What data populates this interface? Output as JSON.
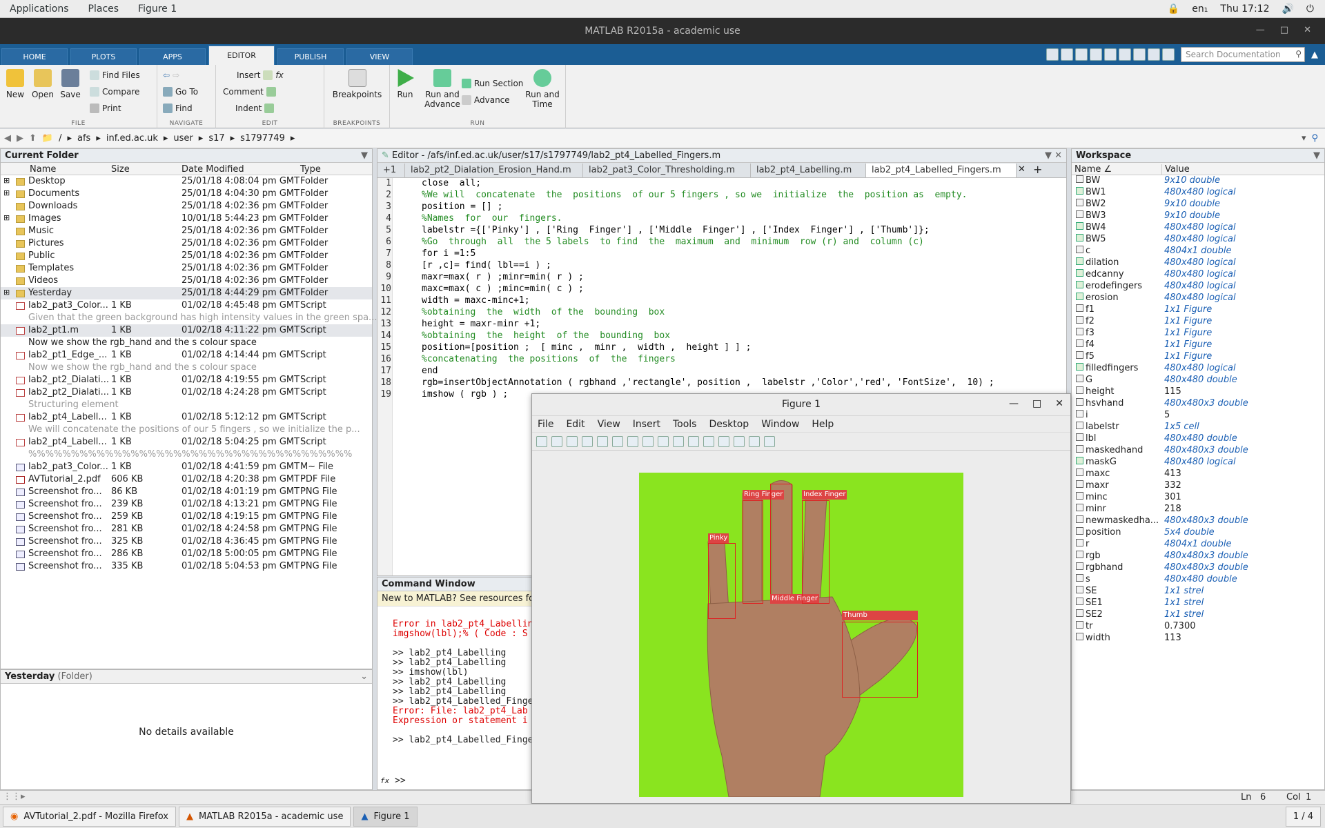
{
  "topbar": {
    "applications": "Applications",
    "places": "Places",
    "figure": "Figure 1",
    "lang": "en₁",
    "clock": "Thu 17:12"
  },
  "window": {
    "title": "MATLAB R2015a - academic use"
  },
  "ribbon_tabs": [
    "HOME",
    "PLOTS",
    "APPS",
    "EDITOR",
    "PUBLISH",
    "VIEW"
  ],
  "doc_search_placeholder": "Search Documentation",
  "ribbon": {
    "file": {
      "new": "New",
      "open": "Open",
      "save": "Save",
      "find_files": "Find Files",
      "compare": "Compare",
      "print": "Print",
      "label": "FILE"
    },
    "navigate": {
      "goto": "Go To",
      "find": "Find",
      "label": "NAVIGATE"
    },
    "edit": {
      "insert": "Insert",
      "comment": "Comment",
      "indent": "Indent",
      "label": "EDIT"
    },
    "breakpoints": {
      "btn": "Breakpoints",
      "label": "BREAKPOINTS"
    },
    "run": {
      "run": "Run",
      "run_advance": "Run and\nAdvance",
      "run_section": "Run Section",
      "advance": "Advance",
      "run_time": "Run and\nTime",
      "label": "RUN"
    }
  },
  "address": [
    "/",
    "afs",
    "inf.ed.ac.uk",
    "user",
    "s17",
    "s1797749"
  ],
  "current_folder": {
    "title": "Current Folder",
    "columns": [
      "Name",
      "Size",
      "Date Modified",
      "Type"
    ],
    "rows": [
      {
        "name": "Desktop",
        "size": "",
        "date": "25/01/18  4:08:04 pm GMT",
        "type": "Folder",
        "kind": "folder",
        "expand": true
      },
      {
        "name": "Documents",
        "size": "",
        "date": "25/01/18  4:04:30 pm GMT",
        "type": "Folder",
        "kind": "folder",
        "expand": true
      },
      {
        "name": "Downloads",
        "size": "",
        "date": "25/01/18  4:02:36 pm GMT",
        "type": "Folder",
        "kind": "folder"
      },
      {
        "name": "Images",
        "size": "",
        "date": "10/01/18  5:44:23 pm GMT",
        "type": "Folder",
        "kind": "folder",
        "expand": true
      },
      {
        "name": "Music",
        "size": "",
        "date": "25/01/18  4:02:36 pm GMT",
        "type": "Folder",
        "kind": "folder"
      },
      {
        "name": "Pictures",
        "size": "",
        "date": "25/01/18  4:02:36 pm GMT",
        "type": "Folder",
        "kind": "folder"
      },
      {
        "name": "Public",
        "size": "",
        "date": "25/01/18  4:02:36 pm GMT",
        "type": "Folder",
        "kind": "folder"
      },
      {
        "name": "Templates",
        "size": "",
        "date": "25/01/18  4:02:36 pm GMT",
        "type": "Folder",
        "kind": "folder"
      },
      {
        "name": "Videos",
        "size": "",
        "date": "25/01/18  4:02:36 pm GMT",
        "type": "Folder",
        "kind": "folder"
      },
      {
        "name": "Yesterday",
        "size": "",
        "date": "25/01/18  4:44:29 pm GMT",
        "type": "Folder",
        "kind": "folder",
        "expand": true,
        "sel": true
      },
      {
        "name": "lab2_pat3_Color...",
        "size": "1 KB",
        "date": "01/02/18  4:45:48 pm GMT",
        "type": "Script",
        "kind": "mfile"
      },
      {
        "desc": "Given that the green background has high intensity values in the green spa..."
      },
      {
        "name": "lab2_pt1.m",
        "size": "1 KB",
        "date": "01/02/18  4:11:22 pm GMT",
        "type": "Script",
        "kind": "mfile",
        "sel": true
      },
      {
        "desc": "Now we show  the  rgb_hand  and  the s colour  space",
        "dark": true
      },
      {
        "name": "lab2_pt1_Edge_...",
        "size": "1 KB",
        "date": "01/02/18  4:14:44 pm GMT",
        "type": "Script",
        "kind": "mfile"
      },
      {
        "desc": "Now we show  the  rgb_hand  and  the s colour  space"
      },
      {
        "name": "lab2_pt2_Dialati...",
        "size": "1 KB",
        "date": "01/02/18  4:19:55 pm GMT",
        "type": "Script",
        "kind": "mfile"
      },
      {
        "name": "lab2_pt2_Dialati...",
        "size": "1 KB",
        "date": "01/02/18  4:24:28 pm GMT",
        "type": "Script",
        "kind": "mfile"
      },
      {
        "desc": "Structuring element"
      },
      {
        "name": "lab2_pt4_Labell...",
        "size": "1 KB",
        "date": "01/02/18  5:12:12 pm GMT",
        "type": "Script",
        "kind": "mfile"
      },
      {
        "desc": "We will  concatenate  the  positions  of our 5 fingers , so we  initialize  the  p..."
      },
      {
        "name": "lab2_pt4_Labell...",
        "size": "1 KB",
        "date": "01/02/18  5:04:25 pm GMT",
        "type": "Script",
        "kind": "mfile"
      },
      {
        "desc": "%%%%%%%%%%%%%%%%%%%%%%%%%%%%%%%%%%%%%%"
      },
      {
        "name": "lab2_pat3_Color...",
        "size": "1 KB",
        "date": "01/02/18  4:41:59 pm GMT",
        "type": "M~ File",
        "kind": "png"
      },
      {
        "name": "AVTutorial_2.pdf",
        "size": "606 KB",
        "date": "01/02/18  4:20:38 pm GMT",
        "type": "PDF File",
        "kind": "pdf"
      },
      {
        "name": "Screenshot fro...",
        "size": "86 KB",
        "date": "01/02/18  4:01:19 pm GMT",
        "type": "PNG File",
        "kind": "png"
      },
      {
        "name": "Screenshot fro...",
        "size": "239 KB",
        "date": "01/02/18  4:13:21 pm GMT",
        "type": "PNG File",
        "kind": "png"
      },
      {
        "name": "Screenshot fro...",
        "size": "259 KB",
        "date": "01/02/18  4:19:15 pm GMT",
        "type": "PNG File",
        "kind": "png"
      },
      {
        "name": "Screenshot fro...",
        "size": "281 KB",
        "date": "01/02/18  4:24:58 pm GMT",
        "type": "PNG File",
        "kind": "png"
      },
      {
        "name": "Screenshot fro...",
        "size": "325 KB",
        "date": "01/02/18  4:36:45 pm GMT",
        "type": "PNG File",
        "kind": "png"
      },
      {
        "name": "Screenshot fro...",
        "size": "286 KB",
        "date": "01/02/18  5:00:05 pm GMT",
        "type": "PNG File",
        "kind": "png"
      },
      {
        "name": "Screenshot fro...",
        "size": "335 KB",
        "date": "01/02/18  5:04:53 pm GMT",
        "type": "PNG File",
        "kind": "png"
      }
    ]
  },
  "details": {
    "title": "Yesterday",
    "subtitle": "(Folder)",
    "empty": "No details available"
  },
  "editor": {
    "title": "Editor - /afs/inf.ed.ac.uk/user/s17/s1797749/lab2_pt4_Labelled_Fingers.m",
    "tabs": [
      "lab2_pt2_Dialation_Erosion_Hand.m",
      "lab2_pat3_Color_Thresholding.m",
      "lab2_pt4_Labelling.m",
      "lab2_pt4_Labelled_Fingers.m"
    ],
    "lines": [
      {
        "n": "1",
        "t": "close  all;"
      },
      {
        "n": "2",
        "t": "%We will  concatenate  the  positions  of our 5 fingers , so we  initialize  the  position as  empty.",
        "c": true
      },
      {
        "n": "3",
        "t": "position = [] ;"
      },
      {
        "n": "4",
        "t": "%Names  for  our  fingers.",
        "c": true
      },
      {
        "n": "5",
        "t": "labelstr ={['Pinky'] , ['Ring  Finger'] , ['Middle  Finger'] , ['Index  Finger'] , ['Thumb']};"
      },
      {
        "n": "6",
        "t": "%Go  through  all  the 5 labels  to find  the  maximum  and  minimum  row (r) and  column (c)",
        "c": true
      },
      {
        "n": "7",
        "t": "for i =1:5"
      },
      {
        "n": "8",
        "t": "[r ,c]= find( lbl==i ) ;"
      },
      {
        "n": "9",
        "t": "maxr=max( r ) ;minr=min( r ) ;"
      },
      {
        "n": "10",
        "t": "maxc=max( c ) ;minc=min( c ) ;"
      },
      {
        "n": "11",
        "t": "width = maxc-minc+1;"
      },
      {
        "n": "12",
        "t": "%obtaining  the  width  of the  bounding  box",
        "c": true
      },
      {
        "n": "13",
        "t": "height = maxr-minr +1;"
      },
      {
        "n": "14",
        "t": "%obtaining  the  height  of the  bounding  box",
        "c": true
      },
      {
        "n": "15",
        "t": "position=[position ;  [ minc ,  minr ,  width ,  height ] ] ;"
      },
      {
        "n": "16",
        "t": "%concatenating  the positions  of  the  fingers",
        "c": true
      },
      {
        "n": "17",
        "t": "end"
      },
      {
        "n": "18",
        "t": "rgb=insertObjectAnnotation ( rgbhand ,'rectangle', position ,  labelstr ,'Color','red', 'FontSize',  10) ;"
      },
      {
        "n": "19",
        "t": "imshow ( rgb ) ;"
      }
    ]
  },
  "command": {
    "title": "Command Window",
    "banner": "New to MATLAB? See resources for",
    "lines": [
      {
        "t": "Error in lab2_pt4_Labellin",
        "e": true
      },
      {
        "t": "imgshow(lbl);% ( Code : S",
        "e": true
      },
      {
        "t": ""
      },
      {
        "t": ">> lab2_pt4_Labelling"
      },
      {
        "t": ">> lab2_pt4_Labelling"
      },
      {
        "t": ">> imshow(lbl)"
      },
      {
        "t": ">> lab2_pt4_Labelling"
      },
      {
        "t": ">> lab2_pt4_Labelling"
      },
      {
        "t": ">> lab2_pt4_Labelled_Finge"
      },
      {
        "t": "Error: File: lab2_pt4_Lab",
        "e": true
      },
      {
        "t": "Expression or statement i",
        "e": true
      },
      {
        "t": ""
      },
      {
        "t": ">> lab2_pt4_Labelled_Finge"
      }
    ],
    "prompt": ">>"
  },
  "workspace": {
    "title": "Workspace",
    "columns": [
      "Name ∠",
      "Value"
    ],
    "rows": [
      {
        "n": "BW",
        "v": "9x10 double",
        "i": "grid"
      },
      {
        "n": "BW1",
        "v": "480x480 logical",
        "i": "chk"
      },
      {
        "n": "BW2",
        "v": "9x10 double",
        "i": "grid"
      },
      {
        "n": "BW3",
        "v": "9x10 double",
        "i": "grid"
      },
      {
        "n": "BW4",
        "v": "480x480 logical",
        "i": "chk"
      },
      {
        "n": "BW5",
        "v": "480x480 logical",
        "i": "chk"
      },
      {
        "n": "c",
        "v": "4804x1 double",
        "i": "grid"
      },
      {
        "n": "dilation",
        "v": "480x480 logical",
        "i": "chk"
      },
      {
        "n": "edcanny",
        "v": "480x480 logical",
        "i": "chk"
      },
      {
        "n": "erodefingers",
        "v": "480x480 logical",
        "i": "chk"
      },
      {
        "n": "erosion",
        "v": "480x480 logical",
        "i": "chk"
      },
      {
        "n": "f1",
        "v": "1x1 Figure",
        "i": "obj"
      },
      {
        "n": "f2",
        "v": "1x1 Figure",
        "i": "obj"
      },
      {
        "n": "f3",
        "v": "1x1 Figure",
        "i": "obj"
      },
      {
        "n": "f4",
        "v": "1x1 Figure",
        "i": "obj"
      },
      {
        "n": "f5",
        "v": "1x1 Figure",
        "i": "obj"
      },
      {
        "n": "filledfingers",
        "v": "480x480 logical",
        "i": "chk"
      },
      {
        "n": "G",
        "v": "480x480 double",
        "i": "grid"
      },
      {
        "n": "height",
        "v": "115",
        "i": "grid",
        "p": true
      },
      {
        "n": "hsvhand",
        "v": "480x480x3 double",
        "i": "grid"
      },
      {
        "n": "i",
        "v": "5",
        "i": "grid",
        "p": true
      },
      {
        "n": "labelstr",
        "v": "1x5 cell",
        "i": "cell"
      },
      {
        "n": "lbl",
        "v": "480x480 double",
        "i": "grid"
      },
      {
        "n": "maskedhand",
        "v": "480x480x3 double",
        "i": "grid"
      },
      {
        "n": "maskG",
        "v": "480x480 logical",
        "i": "chk"
      },
      {
        "n": "maxc",
        "v": "413",
        "i": "grid",
        "p": true
      },
      {
        "n": "maxr",
        "v": "332",
        "i": "grid",
        "p": true
      },
      {
        "n": "minc",
        "v": "301",
        "i": "grid",
        "p": true
      },
      {
        "n": "minr",
        "v": "218",
        "i": "grid",
        "p": true
      },
      {
        "n": "newmaskedha...",
        "v": "480x480x3 double",
        "i": "grid"
      },
      {
        "n": "position",
        "v": "5x4 double",
        "i": "grid"
      },
      {
        "n": "r",
        "v": "4804x1 double",
        "i": "grid"
      },
      {
        "n": "rgb",
        "v": "480x480x3 double",
        "i": "grid"
      },
      {
        "n": "rgbhand",
        "v": "480x480x3 double",
        "i": "grid"
      },
      {
        "n": "s",
        "v": "480x480 double",
        "i": "grid"
      },
      {
        "n": "SE",
        "v": "1x1 strel",
        "i": "obj"
      },
      {
        "n": "SE1",
        "v": "1x1 strel",
        "i": "obj"
      },
      {
        "n": "SE2",
        "v": "1x1 strel",
        "i": "obj"
      },
      {
        "n": "tr",
        "v": "0.7300",
        "i": "grid",
        "p": true
      },
      {
        "n": "width",
        "v": "113",
        "i": "grid",
        "p": true
      }
    ]
  },
  "status": {
    "ln_label": "Ln",
    "ln": "6",
    "col_label": "Col",
    "col": "1"
  },
  "figure": {
    "title": "Figure 1",
    "menu": [
      "File",
      "Edit",
      "View",
      "Insert",
      "Tools",
      "Desktop",
      "Window",
      "Help"
    ],
    "labels": [
      "Pinky",
      "Ring  Finger",
      "Middle  Finger",
      "Index  Finger",
      "Thumb"
    ]
  },
  "taskbar": {
    "items": [
      "AVTutorial_2.pdf - Mozilla Firefox",
      "MATLAB R2015a - academic use",
      "Figure 1"
    ],
    "pager": "1 / 4"
  },
  "colors": {
    "ribbon_blue": "#1b5d94",
    "comment_green": "#228B22",
    "error_red": "#d00000",
    "figure_green": "#8ae41f",
    "bbox_red": "#d22222"
  }
}
